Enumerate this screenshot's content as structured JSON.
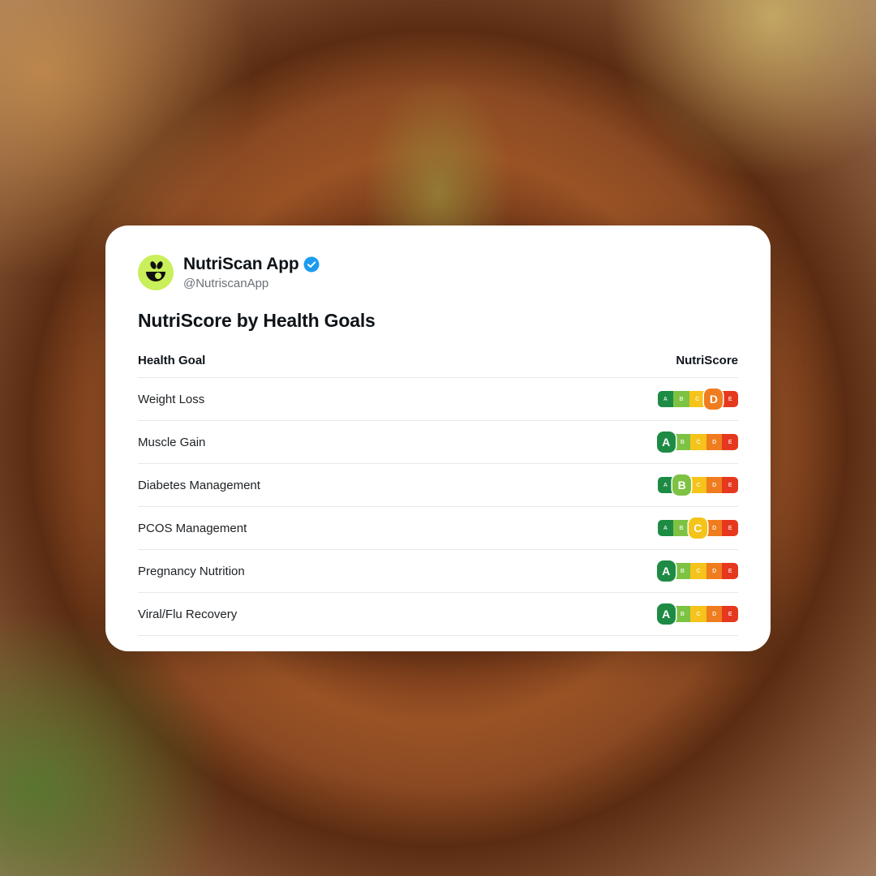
{
  "app": {
    "display_name": "NutriScan App",
    "handle": "@NutriscanApp",
    "verified": true,
    "avatar_color": "#c9ef5a"
  },
  "title": "NutriScore by Health Goals",
  "table": {
    "headers": {
      "goal": "Health Goal",
      "score": "NutriScore"
    },
    "grades": [
      "A",
      "B",
      "C",
      "D",
      "E"
    ],
    "grade_colors": [
      "#1e8b45",
      "#7dc243",
      "#f5c31a",
      "#ef7d1f",
      "#e5381f"
    ],
    "rows": [
      {
        "goal": "Weight Loss",
        "score": "D"
      },
      {
        "goal": "Muscle Gain",
        "score": "A"
      },
      {
        "goal": "Diabetes Management",
        "score": "B"
      },
      {
        "goal": "PCOS Management",
        "score": "C"
      },
      {
        "goal": "Pregnancy Nutrition",
        "score": "A"
      },
      {
        "goal": "Viral/Flu Recovery",
        "score": "A"
      }
    ]
  }
}
